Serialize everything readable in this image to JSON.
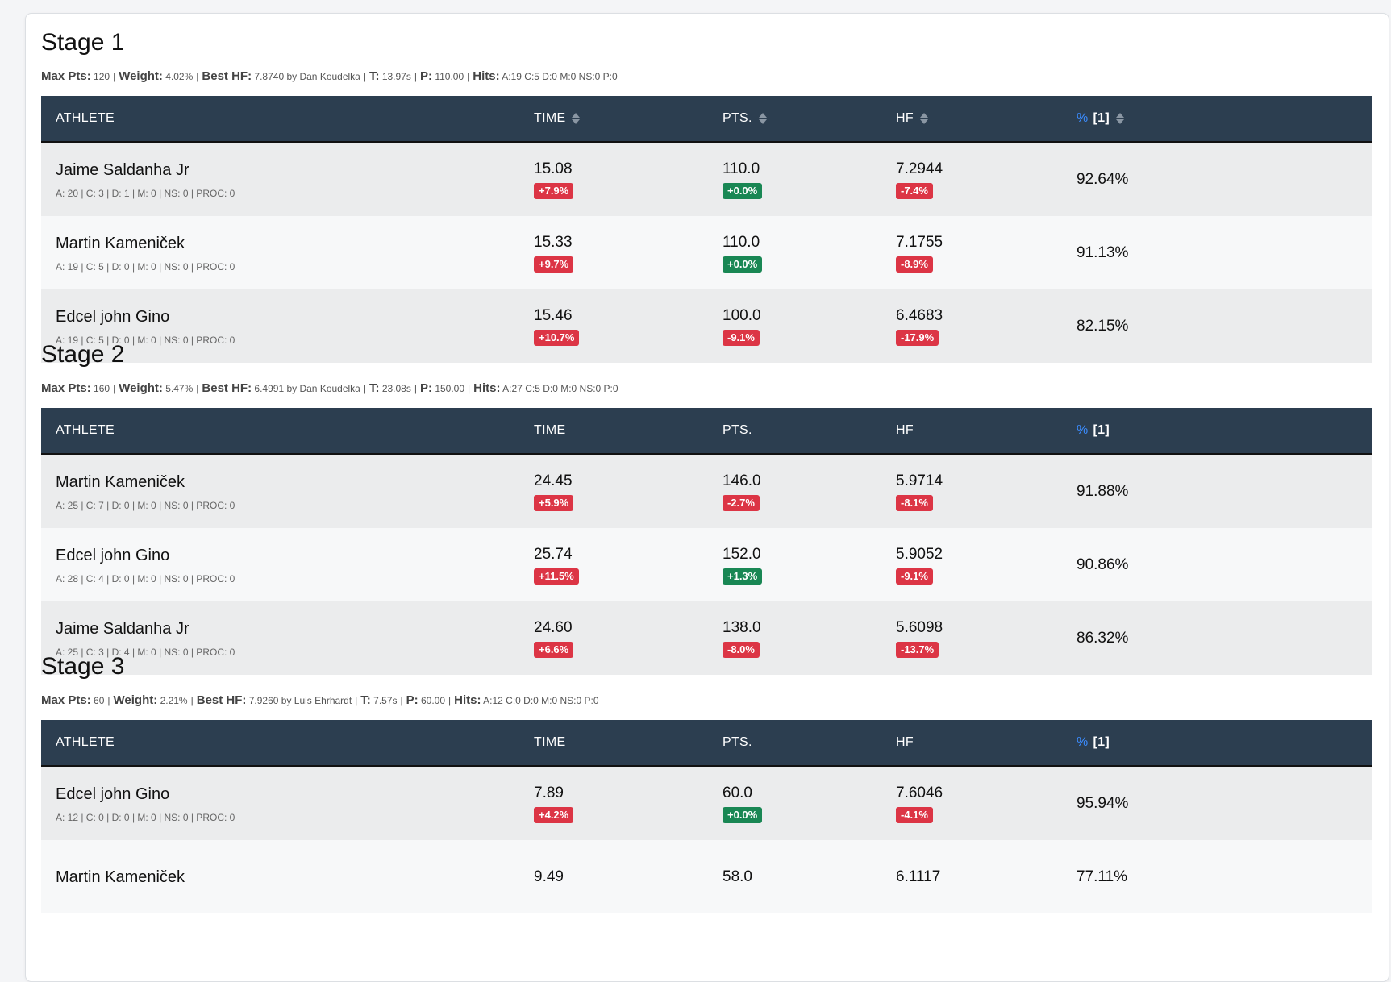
{
  "headers": {
    "athlete": "ATHLETE",
    "time": "TIME",
    "pts": "PTS.",
    "hf": "HF",
    "pct": "%",
    "ref": "[1]"
  },
  "labels": {
    "max_pts": "Max Pts:",
    "weight": "Weight:",
    "best_hf": "Best HF:",
    "t": "T:",
    "p": "P:",
    "hits": "Hits:"
  },
  "colors": {
    "header_bg": "#2c3e50",
    "badge_red": "#dc3545",
    "badge_green": "#198754",
    "link_blue": "#3b8cff"
  },
  "stages": [
    {
      "title": "Stage 1",
      "max_pts": "120",
      "weight": "4.02%",
      "best_hf": "7.8740 by Dan Koudelka",
      "t": "13.97s",
      "p": "110.00",
      "hits": "A:19 C:5 D:0 M:0 NS:0 P:0",
      "sortable": true,
      "rows": [
        {
          "name": "Jaime Saldanha Jr",
          "hits": "A: 20 | C: 3 | D: 1 | M: 0 | NS: 0 | PROC: 0",
          "time": "15.08",
          "time_diff": "+7.9%",
          "time_diff_tone": "neg",
          "pts": "110.0",
          "pts_diff": "+0.0%",
          "pts_diff_tone": "pos",
          "hf": "7.2944",
          "hf_diff": "-7.4%",
          "hf_diff_tone": "neg",
          "pct": "92.64%"
        },
        {
          "name": "Martin Kameniček",
          "hits": "A: 19 | C: 5 | D: 0 | M: 0 | NS: 0 | PROC: 0",
          "time": "15.33",
          "time_diff": "+9.7%",
          "time_diff_tone": "neg",
          "pts": "110.0",
          "pts_diff": "+0.0%",
          "pts_diff_tone": "pos",
          "hf": "7.1755",
          "hf_diff": "-8.9%",
          "hf_diff_tone": "neg",
          "pct": "91.13%"
        },
        {
          "name": "Edcel john Gino",
          "hits": "A: 19 | C: 5 | D: 0 | M: 0 | NS: 0 | PROC: 0",
          "time": "15.46",
          "time_diff": "+10.7%",
          "time_diff_tone": "neg",
          "pts": "100.0",
          "pts_diff": "-9.1%",
          "pts_diff_tone": "neg",
          "hf": "6.4683",
          "hf_diff": "-17.9%",
          "hf_diff_tone": "neg",
          "pct": "82.15%"
        }
      ]
    },
    {
      "title": "Stage 2",
      "max_pts": "160",
      "weight": "5.47%",
      "best_hf": "6.4991 by Dan Koudelka",
      "t": "23.08s",
      "p": "150.00",
      "hits": "A:27 C:5 D:0 M:0 NS:0 P:0",
      "sortable": false,
      "rows": [
        {
          "name": "Martin Kameniček",
          "hits": "A: 25 | C: 7 | D: 0 | M: 0 | NS: 0 | PROC: 0",
          "time": "24.45",
          "time_diff": "+5.9%",
          "time_diff_tone": "neg",
          "pts": "146.0",
          "pts_diff": "-2.7%",
          "pts_diff_tone": "neg",
          "hf": "5.9714",
          "hf_diff": "-8.1%",
          "hf_diff_tone": "neg",
          "pct": "91.88%"
        },
        {
          "name": "Edcel john Gino",
          "hits": "A: 28 | C: 4 | D: 0 | M: 0 | NS: 0 | PROC: 0",
          "time": "25.74",
          "time_diff": "+11.5%",
          "time_diff_tone": "neg",
          "pts": "152.0",
          "pts_diff": "+1.3%",
          "pts_diff_tone": "pos",
          "hf": "5.9052",
          "hf_diff": "-9.1%",
          "hf_diff_tone": "neg",
          "pct": "90.86%"
        },
        {
          "name": "Jaime Saldanha Jr",
          "hits": "A: 25 | C: 3 | D: 4 | M: 0 | NS: 0 | PROC: 0",
          "time": "24.60",
          "time_diff": "+6.6%",
          "time_diff_tone": "neg",
          "pts": "138.0",
          "pts_diff": "-8.0%",
          "pts_diff_tone": "neg",
          "hf": "5.6098",
          "hf_diff": "-13.7%",
          "hf_diff_tone": "neg",
          "pct": "86.32%"
        }
      ]
    },
    {
      "title": "Stage 3",
      "max_pts": "60",
      "weight": "2.21%",
      "best_hf": "7.9260 by Luis Ehrhardt",
      "t": "7.57s",
      "p": "60.00",
      "hits": "A:12 C:0 D:0 M:0 NS:0 P:0",
      "sortable": false,
      "rows": [
        {
          "name": "Edcel john Gino",
          "hits": "A: 12 | C: 0 | D: 0 | M: 0 | NS: 0 | PROC: 0",
          "time": "7.89",
          "time_diff": "+4.2%",
          "time_diff_tone": "neg",
          "pts": "60.0",
          "pts_diff": "+0.0%",
          "pts_diff_tone": "pos",
          "hf": "7.6046",
          "hf_diff": "-4.1%",
          "hf_diff_tone": "neg",
          "pct": "95.94%"
        },
        {
          "name": "Martin Kameniček",
          "hits": "",
          "time": "9.49",
          "time_diff": "",
          "time_diff_tone": "neg",
          "pts": "58.0",
          "pts_diff": "",
          "pts_diff_tone": "neg",
          "hf": "6.1117",
          "hf_diff": "",
          "hf_diff_tone": "neg",
          "pct": "77.11%"
        }
      ]
    }
  ]
}
